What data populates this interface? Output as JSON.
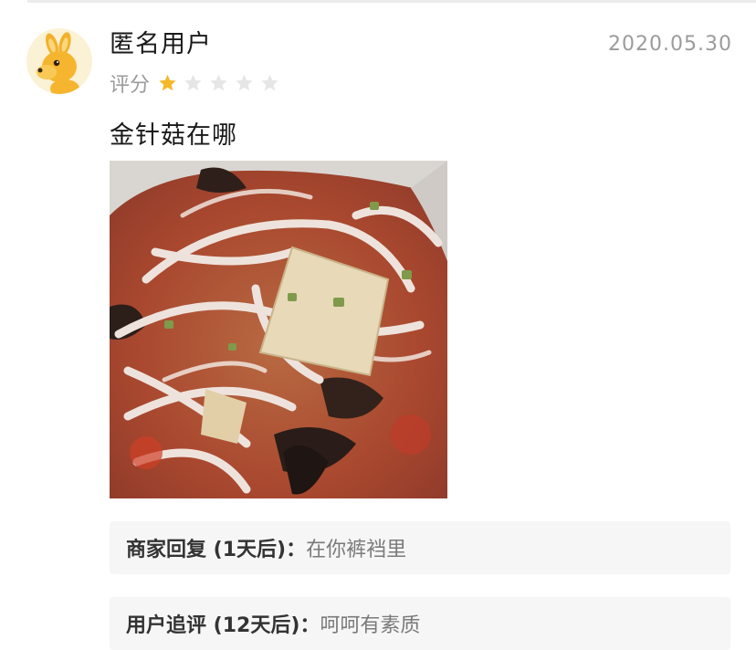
{
  "review": {
    "username": "匿名用户",
    "date": "2020.05.30",
    "rating_label": "评分",
    "rating": 1,
    "rating_max": 5,
    "comment": "金针菇在哪"
  },
  "replies": [
    {
      "label": "商家回复 (1天后)：",
      "text": "在你裤裆里"
    },
    {
      "label": "用户追评 (12天后)：",
      "text": "呵呵有素质"
    }
  ],
  "colors": {
    "star_on": "#f5b82a",
    "star_off": "#e6e6e6",
    "muted_text": "#9b9b9b"
  }
}
